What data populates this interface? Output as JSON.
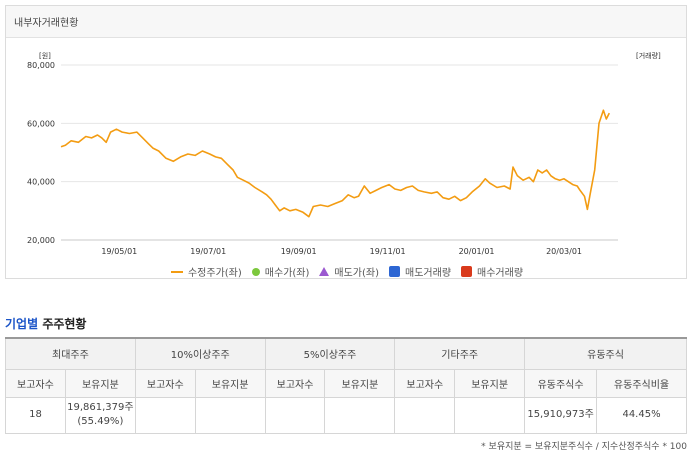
{
  "panel": {
    "title": "내부자거래현황"
  },
  "chart_data": {
    "type": "line",
    "y_unit": "[원]",
    "y2_unit": "[거래량]",
    "ylim": [
      20000,
      80000
    ],
    "yticks": [
      "80,000",
      "60,000",
      "40,000",
      "20,000"
    ],
    "ytick_values": [
      80000,
      60000,
      40000,
      20000
    ],
    "xticks": [
      "19/05/01",
      "19/07/01",
      "19/09/01",
      "19/11/01",
      "20/01/01",
      "20/03/01"
    ],
    "xtick_dates": [
      "2019-05-01",
      "2019-07-01",
      "2019-09-01",
      "2019-11-01",
      "2020-01-01",
      "2020-03-01"
    ],
    "xlim": [
      "2019-03-22",
      "2020-04-07"
    ],
    "series": [
      {
        "name": "수정주가(좌)",
        "color": "#f39c12",
        "points": [
          [
            "2019-03-22",
            52000
          ],
          [
            "2019-03-25",
            52500
          ],
          [
            "2019-03-29",
            54000
          ],
          [
            "2019-04-03",
            53500
          ],
          [
            "2019-04-08",
            55500
          ],
          [
            "2019-04-12",
            55000
          ],
          [
            "2019-04-16",
            56000
          ],
          [
            "2019-04-19",
            55000
          ],
          [
            "2019-04-22",
            53500
          ],
          [
            "2019-04-25",
            57000
          ],
          [
            "2019-04-29",
            58000
          ],
          [
            "2019-05-03",
            57000
          ],
          [
            "2019-05-08",
            56500
          ],
          [
            "2019-05-13",
            57000
          ],
          [
            "2019-05-17",
            55000
          ],
          [
            "2019-05-21",
            53000
          ],
          [
            "2019-05-24",
            51500
          ],
          [
            "2019-05-28",
            50500
          ],
          [
            "2019-06-02",
            48000
          ],
          [
            "2019-06-07",
            47000
          ],
          [
            "2019-06-12",
            48500
          ],
          [
            "2019-06-17",
            49500
          ],
          [
            "2019-06-22",
            49000
          ],
          [
            "2019-06-27",
            50500
          ],
          [
            "2019-07-02",
            49500
          ],
          [
            "2019-07-06",
            48500
          ],
          [
            "2019-07-10",
            48000
          ],
          [
            "2019-07-14",
            46000
          ],
          [
            "2019-07-18",
            44000
          ],
          [
            "2019-07-21",
            41500
          ],
          [
            "2019-07-25",
            40500
          ],
          [
            "2019-07-29",
            39500
          ],
          [
            "2019-08-02",
            38000
          ],
          [
            "2019-08-07",
            36500
          ],
          [
            "2019-08-10",
            35500
          ],
          [
            "2019-08-13",
            34000
          ],
          [
            "2019-08-16",
            32000
          ],
          [
            "2019-08-19",
            30000
          ],
          [
            "2019-08-22",
            31000
          ],
          [
            "2019-08-26",
            30000
          ],
          [
            "2019-08-30",
            30500
          ],
          [
            "2019-09-04",
            29500
          ],
          [
            "2019-09-08",
            28000
          ],
          [
            "2019-09-11",
            31500
          ],
          [
            "2019-09-16",
            32000
          ],
          [
            "2019-09-21",
            31500
          ],
          [
            "2019-09-26",
            32500
          ],
          [
            "2019-10-01",
            33500
          ],
          [
            "2019-10-05",
            35500
          ],
          [
            "2019-10-09",
            34500
          ],
          [
            "2019-10-12",
            35000
          ],
          [
            "2019-10-16",
            38500
          ],
          [
            "2019-10-20",
            36000
          ],
          [
            "2019-10-24",
            37000
          ],
          [
            "2019-10-28",
            38000
          ],
          [
            "2019-11-02",
            39000
          ],
          [
            "2019-11-06",
            37500
          ],
          [
            "2019-11-10",
            37000
          ],
          [
            "2019-11-14",
            38000
          ],
          [
            "2019-11-18",
            38500
          ],
          [
            "2019-11-22",
            37000
          ],
          [
            "2019-11-26",
            36500
          ],
          [
            "2019-12-01",
            36000
          ],
          [
            "2019-12-05",
            36500
          ],
          [
            "2019-12-09",
            34500
          ],
          [
            "2019-12-13",
            34000
          ],
          [
            "2019-12-17",
            35000
          ],
          [
            "2019-12-21",
            33500
          ],
          [
            "2019-12-25",
            34500
          ],
          [
            "2019-12-29",
            36500
          ],
          [
            "2020-01-03",
            38500
          ],
          [
            "2020-01-07",
            41000
          ],
          [
            "2020-01-10",
            39500
          ],
          [
            "2020-01-15",
            38000
          ],
          [
            "2020-01-20",
            38500
          ],
          [
            "2020-01-24",
            37500
          ],
          [
            "2020-01-26",
            45000
          ],
          [
            "2020-01-29",
            42000
          ],
          [
            "2020-02-02",
            40500
          ],
          [
            "2020-02-06",
            41500
          ],
          [
            "2020-02-09",
            40000
          ],
          [
            "2020-02-12",
            44000
          ],
          [
            "2020-02-15",
            43000
          ],
          [
            "2020-02-18",
            44000
          ],
          [
            "2020-02-21",
            42000
          ],
          [
            "2020-02-24",
            41000
          ],
          [
            "2020-02-27",
            40500
          ],
          [
            "2020-03-01",
            41000
          ],
          [
            "2020-03-04",
            40000
          ],
          [
            "2020-03-07",
            39000
          ],
          [
            "2020-03-10",
            38500
          ],
          [
            "2020-03-12",
            37000
          ],
          [
            "2020-03-15",
            35000
          ],
          [
            "2020-03-17",
            30500
          ],
          [
            "2020-03-19",
            36000
          ],
          [
            "2020-03-22",
            44000
          ],
          [
            "2020-03-25",
            60000
          ],
          [
            "2020-03-28",
            64500
          ],
          [
            "2020-03-30",
            61500
          ],
          [
            "2020-04-01",
            63500
          ]
        ]
      }
    ],
    "grid": {
      "horizontal": true,
      "vertical": false
    },
    "legend_position": "bottom-center"
  },
  "legend": [
    {
      "label": "수정주가(좌)",
      "shape": "line",
      "color": "#f39c12"
    },
    {
      "label": "매수가(좌)",
      "shape": "dot",
      "color": "#7cc83d"
    },
    {
      "label": "매도가(좌)",
      "shape": "triangle",
      "color": "#9b59d0"
    },
    {
      "label": "매도거래량",
      "shape": "square",
      "color": "#2d66d3"
    },
    {
      "label": "매수거래량",
      "shape": "square",
      "color": "#d93a1c"
    }
  ],
  "section": {
    "title_prefix": "기업별",
    "title_rest": "주주현황"
  },
  "table": {
    "groups": [
      "최대주주",
      "10%이상주주",
      "5%이상주주",
      "기타주주",
      "유동주식"
    ],
    "subheaders": [
      "보고자수",
      "보유지분",
      "보고자수",
      "보유지분",
      "보고자수",
      "보유지분",
      "보고자수",
      "보유지분",
      "유동주식수",
      "유동주식비율"
    ],
    "row": {
      "c1": "18",
      "c2_line1": "19,861,379주",
      "c2_line2": "(55.49%)",
      "c3": "",
      "c4": "",
      "c5": "",
      "c6": "",
      "c7": "",
      "c8": "",
      "c9": "15,910,973주",
      "c10": "44.45%"
    }
  },
  "footnote": "* 보유지분 = 보유지분주식수 / 지수산정주식수 * 100"
}
